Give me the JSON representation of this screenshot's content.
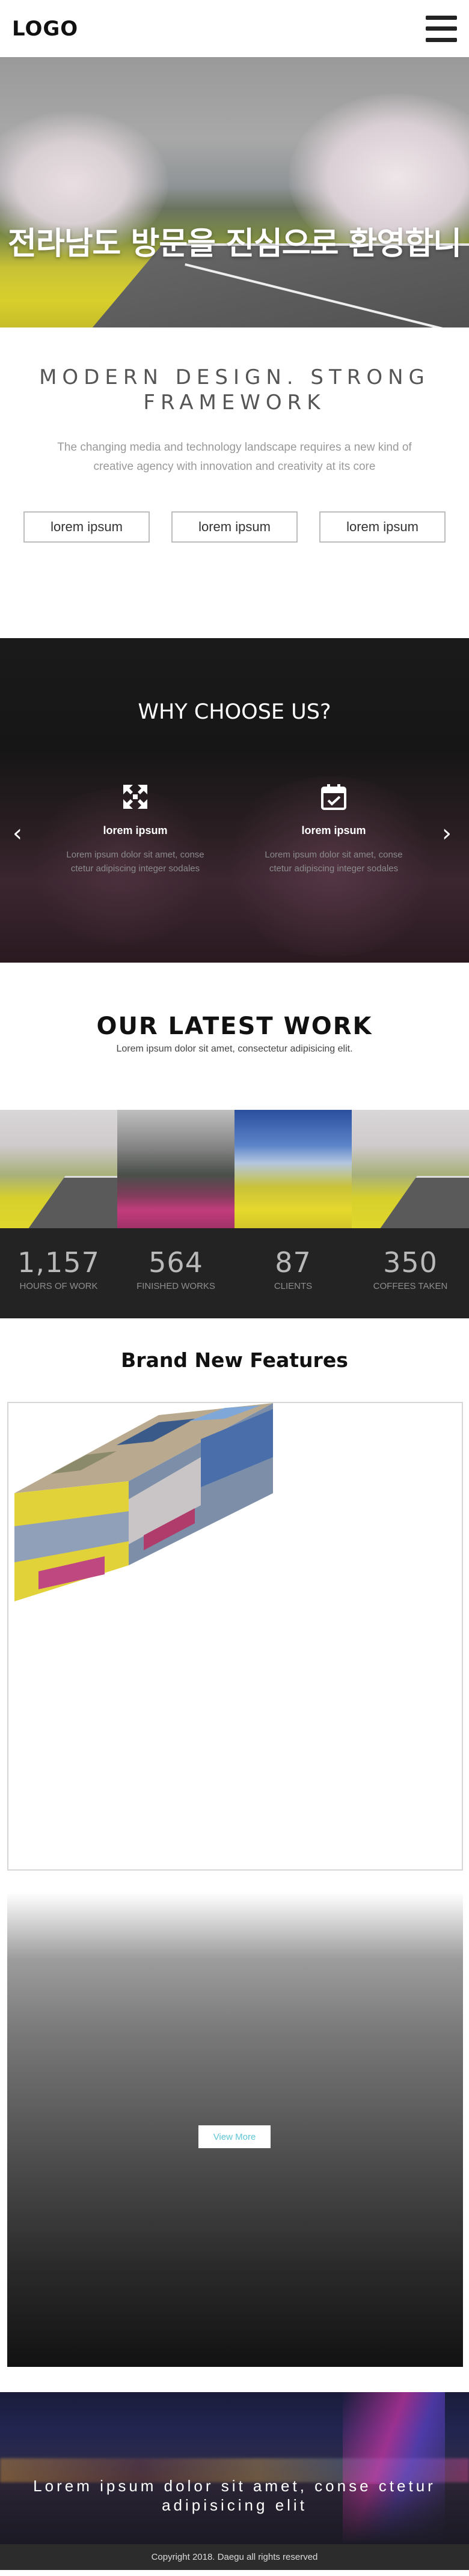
{
  "header": {
    "logo": "LOGO",
    "menu_icon": "hamburger-menu-icon"
  },
  "hero": {
    "title": "전라남도 방문을 진심으로 환영합니"
  },
  "intro": {
    "title": "MODERN DESIGN. STRONG FRAMEWORK",
    "text": "The changing media and technology landscape requires a new kind of creative agency with innovation and creativity at its core",
    "buttons": [
      "lorem ipsum",
      "lorem ipsum",
      "lorem ipsum"
    ]
  },
  "why": {
    "title": "WHY CHOOSE US?",
    "prev_icon": "chevron-left-icon",
    "next_icon": "chevron-right-icon",
    "features": [
      {
        "icon": "expand-arrows-icon",
        "name": "lorem ipsum",
        "desc": "Lorem ipsum dolor sit amet, conse ctetur adipiscing integer sodales"
      },
      {
        "icon": "calendar-check-icon",
        "name": "lorem ipsum",
        "desc": "Lorem ipsum dolor sit amet, conse ctetur adipiscing integer sodales"
      }
    ]
  },
  "latest": {
    "title": "OUR LATEST WORK",
    "subtitle": "Lorem ipsum dolor sit amet, consectetur adipisicing elit."
  },
  "stats": [
    {
      "num": "1,157",
      "label": "HOURS OF WORK"
    },
    {
      "num": "564",
      "label": "FINISHED WORKS"
    },
    {
      "num": "87",
      "label": "CLIENTS"
    },
    {
      "num": "350",
      "label": "COFFEES TAKEN"
    }
  ],
  "brand": {
    "title": "Brand New Features"
  },
  "view_more": {
    "label": "View More"
  },
  "footer": {
    "quote": "Lorem ipsum dolor sit amet, conse ctetur adipisicing elit",
    "copyright": "Copyright 2018. Daegu all rights reserved"
  },
  "colors": {
    "dark_band": "#232323",
    "accent_link": "#5ec6d6",
    "footer_bar": "#2c2c2c"
  }
}
